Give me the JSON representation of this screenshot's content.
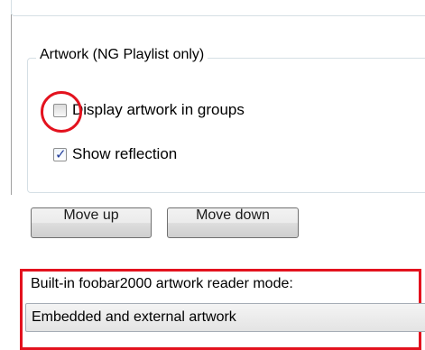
{
  "artwork_group": {
    "title": "Artwork (NG Playlist only)",
    "display_in_groups": {
      "label": "Display artwork in groups",
      "checked": false
    },
    "show_reflection": {
      "label": "Show reflection",
      "checked": true
    }
  },
  "buttons": {
    "move_up": "Move up",
    "move_down": "Move down"
  },
  "reader_mode": {
    "label": "Built-in foobar2000 artwork reader mode:",
    "selected": "Embedded and external artwork"
  },
  "colors": {
    "highlight": "#e3121e",
    "check": "#233e9b"
  }
}
